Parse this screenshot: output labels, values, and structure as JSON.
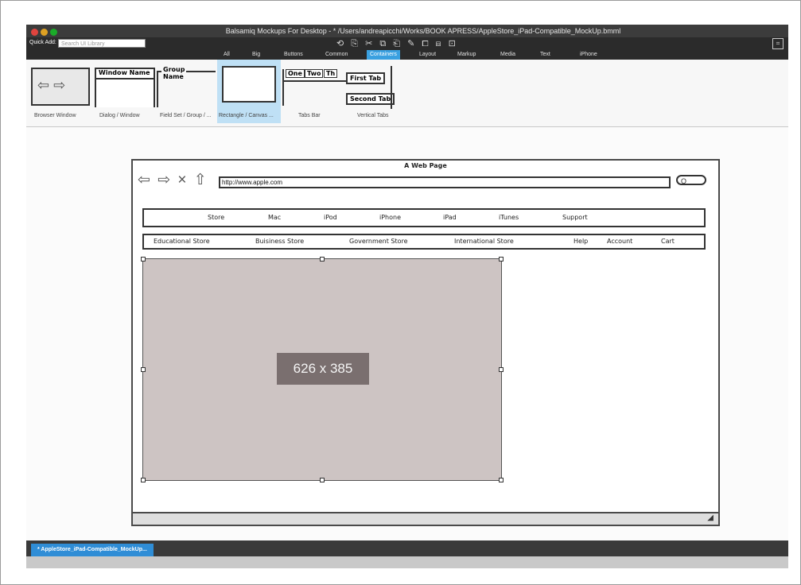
{
  "window": {
    "title": "Balsamiq Mockups For Desktop - * /Users/andreapicchi/Works/BOOK APRESS/AppleStore_iPad-Compatible_MockUp.bmml"
  },
  "toolbar": {
    "quick_add_label": "Quick Add:",
    "search_placeholder": "Search UI Library",
    "icons": [
      "undo-icon",
      "redo-icon",
      "copy-icon",
      "cut-icon",
      "paste-icon",
      "duplicate-icon",
      "edit-icon",
      "group-icon",
      "ungroup-icon",
      "lock-icon"
    ],
    "icon_glyphs": "⟲ ⎘ ✂ ⧉ ⎗ ✎ ⧠ ⧈ ⊡",
    "fullscreen_glyph": "⌗"
  },
  "categories": [
    "All",
    "Big",
    "Buttons",
    "Common",
    "Containers",
    "Layout",
    "Markup",
    "Media",
    "Text",
    "iPhone"
  ],
  "active_category": "Containers",
  "library": {
    "items": [
      {
        "label": "Browser Window"
      },
      {
        "label": "Dialog / Window",
        "sketch_text": "Window Name"
      },
      {
        "label": "Field Set / Group / ...",
        "sketch_text": "Group Name"
      },
      {
        "label": "Rectangle / Canvas ..."
      },
      {
        "label": "Tabs Bar",
        "tabs": [
          "One",
          "Two",
          "Th"
        ]
      },
      {
        "label": "Vertical Tabs",
        "tabs": [
          "First Tab",
          "Second Tab"
        ]
      }
    ]
  },
  "mockup": {
    "title": "A Web Page",
    "url": "http://www.apple.com",
    "nav_glyphs": "⇦ ⇨ × ⇧",
    "search_glyph": "Q",
    "nav_primary": [
      "Store",
      "Mac",
      "iPod",
      "iPhone",
      "iPad",
      "iTunes",
      "Support"
    ],
    "nav_secondary": [
      "Educational Store",
      "Buisiness Store",
      "Government Store",
      "International Store",
      "Help",
      "Account",
      "Cart"
    ],
    "image_label": "626 x 385",
    "resize_glyph": "◢"
  },
  "status": {
    "file_tab": "* AppleStore_iPad-Compatible_MockUp..."
  },
  "colors": {
    "accent": "#3aa0e0",
    "toolbar_bg": "#2b2b2b",
    "image_placeholder": "#cdc4c3",
    "dimension_badge": "#7a6f6f"
  }
}
